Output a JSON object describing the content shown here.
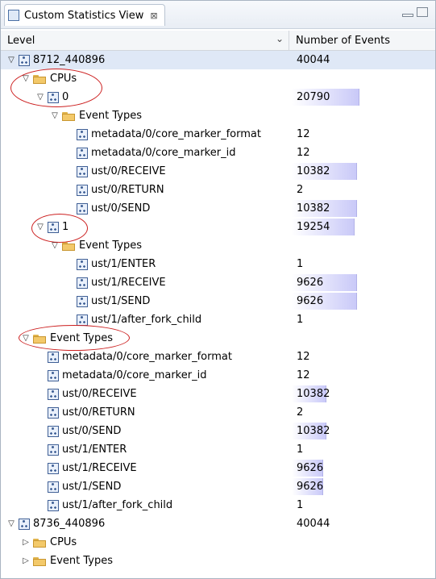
{
  "view": {
    "title": "Custom Statistics View",
    "close_glyph": "⊠"
  },
  "columns": {
    "level": "Level",
    "events": "Number of Events"
  },
  "rows": [
    {
      "label": "8712_440896",
      "events": "40044",
      "indent": 0,
      "toggle": "▽",
      "icon": "node",
      "selected": true,
      "bar": 0
    },
    {
      "label": "CPUs",
      "events": "",
      "indent": 1,
      "toggle": "▽",
      "icon": "folder",
      "bar": 0
    },
    {
      "label": "0",
      "events": "20790",
      "indent": 2,
      "toggle": "▽",
      "icon": "node",
      "bar": 0.52
    },
    {
      "label": "Event Types",
      "events": "",
      "indent": 3,
      "toggle": "▽",
      "icon": "folder",
      "bar": 0
    },
    {
      "label": "metadata/0/core_marker_format",
      "events": "12",
      "indent": 4,
      "toggle": "",
      "icon": "node",
      "bar": 0
    },
    {
      "label": "metadata/0/core_marker_id",
      "events": "12",
      "indent": 4,
      "toggle": "",
      "icon": "node",
      "bar": 0
    },
    {
      "label": "ust/0/RECEIVE",
      "events": "10382",
      "indent": 4,
      "toggle": "",
      "icon": "node",
      "bar": 0.5
    },
    {
      "label": "ust/0/RETURN",
      "events": "2",
      "indent": 4,
      "toggle": "",
      "icon": "node",
      "bar": 0
    },
    {
      "label": "ust/0/SEND",
      "events": "10382",
      "indent": 4,
      "toggle": "",
      "icon": "node",
      "bar": 0.5
    },
    {
      "label": "1",
      "events": "19254",
      "indent": 2,
      "toggle": "▽",
      "icon": "node",
      "bar": 0.48
    },
    {
      "label": "Event Types",
      "events": "",
      "indent": 3,
      "toggle": "▽",
      "icon": "folder",
      "bar": 0
    },
    {
      "label": "ust/1/ENTER",
      "events": "1",
      "indent": 4,
      "toggle": "",
      "icon": "node",
      "bar": 0
    },
    {
      "label": "ust/1/RECEIVE",
      "events": "9626",
      "indent": 4,
      "toggle": "",
      "icon": "node",
      "bar": 0.5
    },
    {
      "label": "ust/1/SEND",
      "events": "9626",
      "indent": 4,
      "toggle": "",
      "icon": "node",
      "bar": 0.5
    },
    {
      "label": "ust/1/after_fork_child",
      "events": "1",
      "indent": 4,
      "toggle": "",
      "icon": "node",
      "bar": 0
    },
    {
      "label": "Event Types",
      "events": "",
      "indent": 1,
      "toggle": "▽",
      "icon": "folder",
      "bar": 0
    },
    {
      "label": "metadata/0/core_marker_format",
      "events": "12",
      "indent": 2,
      "toggle": "",
      "icon": "node",
      "bar": 0
    },
    {
      "label": "metadata/0/core_marker_id",
      "events": "12",
      "indent": 2,
      "toggle": "",
      "icon": "node",
      "bar": 0
    },
    {
      "label": "ust/0/RECEIVE",
      "events": "10382",
      "indent": 2,
      "toggle": "",
      "icon": "node",
      "bar": 0.26
    },
    {
      "label": "ust/0/RETURN",
      "events": "2",
      "indent": 2,
      "toggle": "",
      "icon": "node",
      "bar": 0
    },
    {
      "label": "ust/0/SEND",
      "events": "10382",
      "indent": 2,
      "toggle": "",
      "icon": "node",
      "bar": 0.26
    },
    {
      "label": "ust/1/ENTER",
      "events": "1",
      "indent": 2,
      "toggle": "",
      "icon": "node",
      "bar": 0
    },
    {
      "label": "ust/1/RECEIVE",
      "events": "9626",
      "indent": 2,
      "toggle": "",
      "icon": "node",
      "bar": 0.24
    },
    {
      "label": "ust/1/SEND",
      "events": "9626",
      "indent": 2,
      "toggle": "",
      "icon": "node",
      "bar": 0.24
    },
    {
      "label": "ust/1/after_fork_child",
      "events": "1",
      "indent": 2,
      "toggle": "",
      "icon": "node",
      "bar": 0
    },
    {
      "label": "8736_440896",
      "events": "40044",
      "indent": 0,
      "toggle": "▽",
      "icon": "node",
      "bar": 0
    },
    {
      "label": "CPUs",
      "events": "",
      "indent": 1,
      "toggle": "▷",
      "icon": "folder",
      "bar": 0
    },
    {
      "label": "Event Types",
      "events": "",
      "indent": 1,
      "toggle": "▷",
      "icon": "folder",
      "bar": 0
    }
  ],
  "colors": {
    "highlight_circle": "#cc1f1f",
    "bar_end": "#c9c9f8",
    "selection": "#dfe8f6"
  }
}
